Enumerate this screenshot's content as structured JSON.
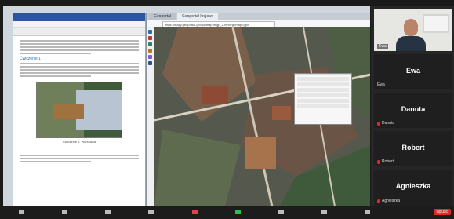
{
  "word": {
    "section_heading": "Ćwiczenie 1",
    "figure_caption": "Ćwiczenie 1. Warszawa"
  },
  "browser": {
    "tabs": [
      {
        "label": "Geoportal"
      },
      {
        "label": "Geoportal krajowy"
      }
    ],
    "address": "https://mapy.geoportal.gov.pl/imap/Imgp_2.html?gpmap=gp0"
  },
  "participants": {
    "video_tile": {
      "name": "Ewa"
    },
    "tiles": [
      {
        "name": "Ewa",
        "label": "Ewa"
      },
      {
        "name": "Danuta",
        "label": "Danuta"
      },
      {
        "name": "Robert",
        "label": "Robert"
      },
      {
        "name": "Agnieszka",
        "label": "Agnieszka"
      }
    ]
  },
  "toolbar": {
    "leave_label": "Opuść"
  },
  "colors": {
    "word_title": "#2b579a",
    "mic_muted": "#e02828",
    "leave": "#e02828",
    "video_on": "#2fbf4a"
  }
}
